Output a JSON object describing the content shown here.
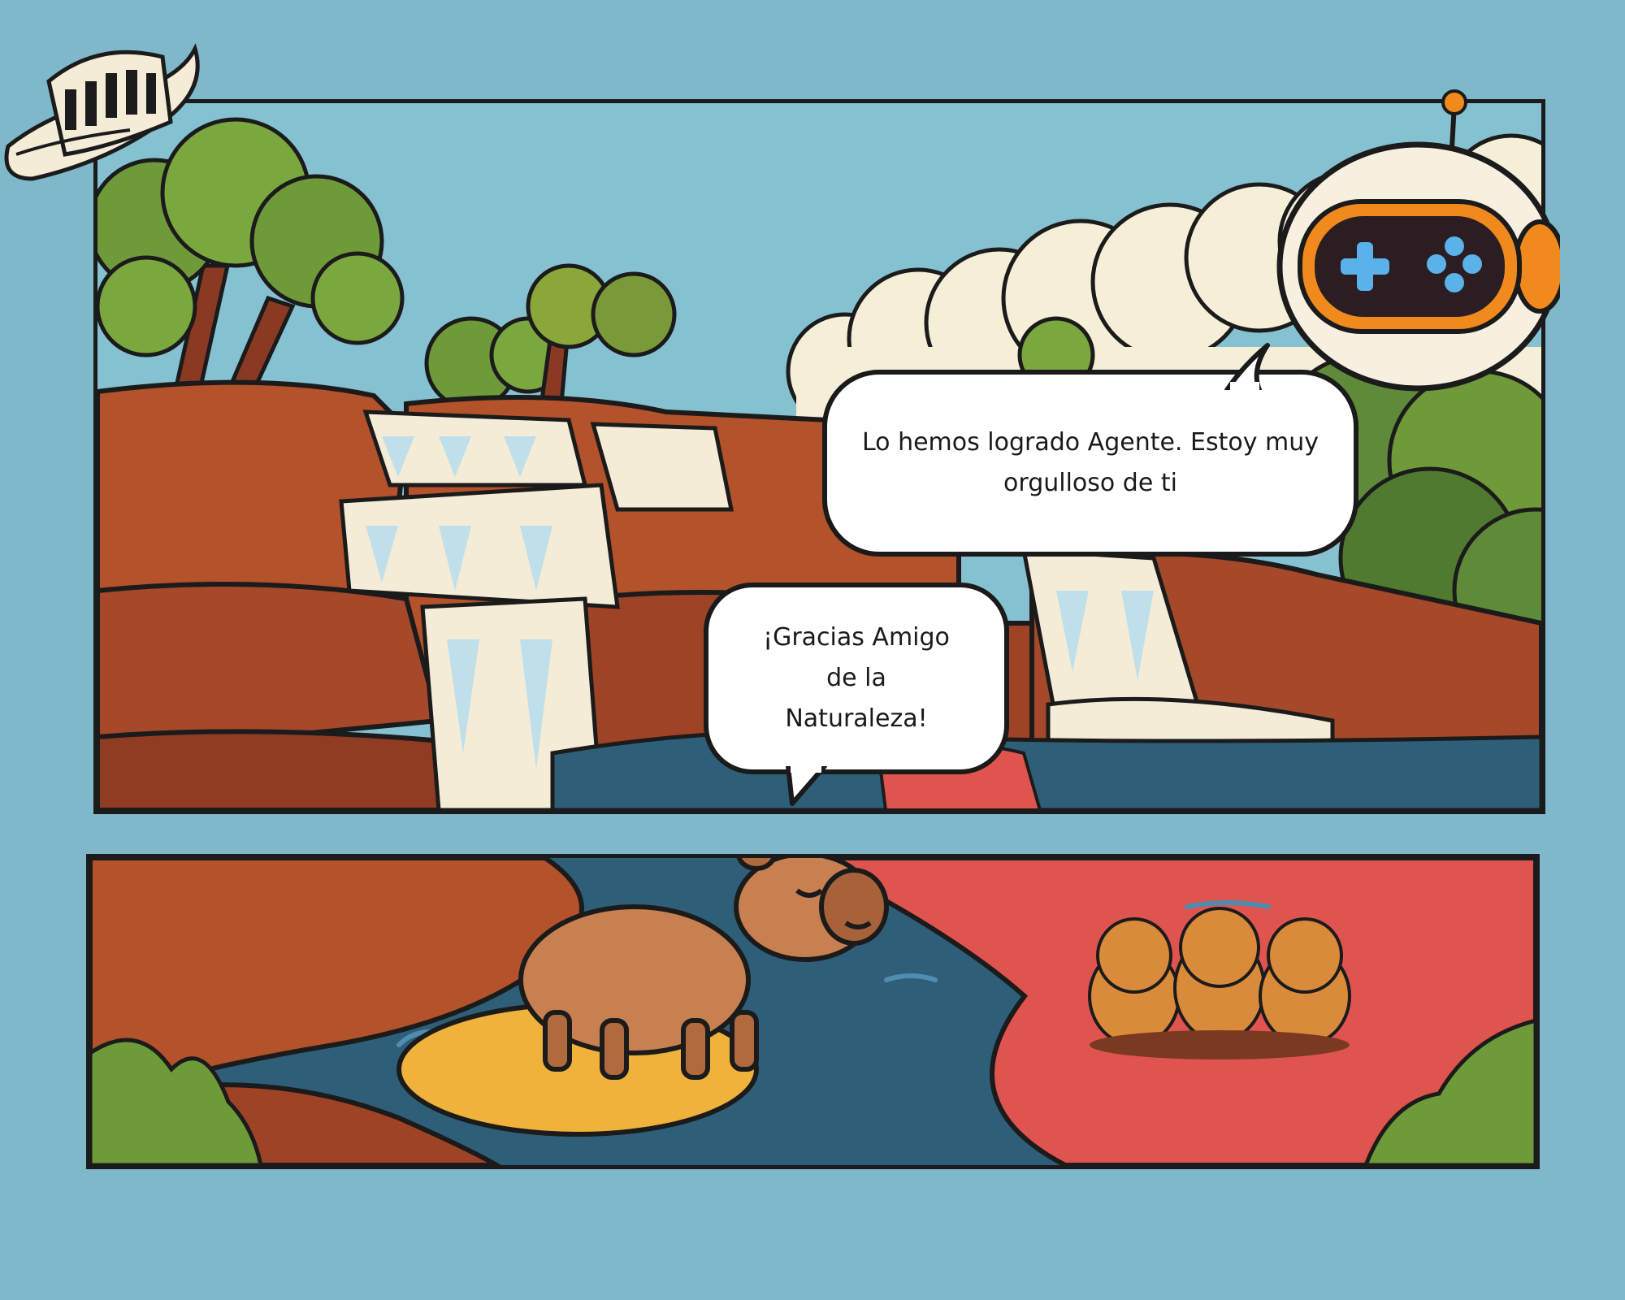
{
  "dialogue": {
    "robot_line": "Lo hemos logrado Agente. Estoy muy orgulloso de ti",
    "capybara_line": "¡Gracias Amigo de la Naturaleza!"
  },
  "colors": {
    "background": "#7fb7cb",
    "sky": "#85c1d0",
    "rock": "#b3522b",
    "water": "#2f5f78",
    "red_river": "#e0544f",
    "foliage": "#7a9a3a",
    "robot_accent": "#f08a1c"
  },
  "icons": {
    "hat": "sombrero-vueltiao-icon",
    "robot": "game-robot-icon",
    "capybara": "capybara-icon",
    "baby_capybaras": "baby-capybara-icon"
  }
}
